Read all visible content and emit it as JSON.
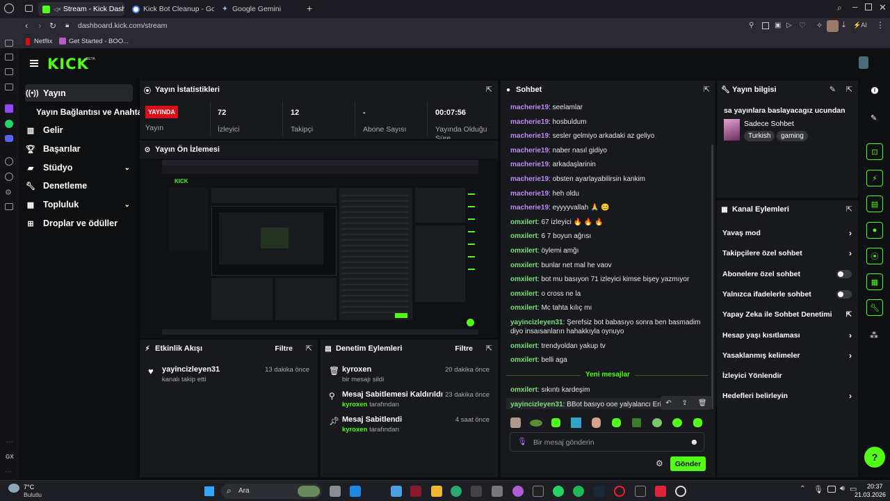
{
  "browser": {
    "tabs": [
      {
        "label": "Stream - Kick Dashbo",
        "active": true
      },
      {
        "label": "Kick Bot Cleanup - Googl",
        "active": false
      },
      {
        "label": "Google Gemini",
        "active": false
      }
    ],
    "url": "dashboard.kick.com/stream",
    "bookmarks": [
      "Netflix",
      "Get Started - BOO..."
    ]
  },
  "app": {
    "logo": "KICK",
    "logo_badge": "BETA",
    "accent": "#53fc18"
  },
  "nav": {
    "items": [
      {
        "label": "Yayın",
        "icon": "broadcast-icon"
      },
      {
        "label": "Yayın Bağlantısı ve Anahtarı"
      },
      {
        "label": "Gelir",
        "icon": "chart-icon"
      },
      {
        "label": "Başarılar",
        "icon": "trophy-icon"
      },
      {
        "label": "Stüdyo",
        "icon": "video-icon"
      },
      {
        "label": "Denetleme",
        "icon": "wrench-icon"
      },
      {
        "label": "Topluluk",
        "icon": "community-icon"
      },
      {
        "label": "Droplar ve ödüller",
        "icon": "gift-icon"
      }
    ]
  },
  "stats": {
    "title": "Yayın İstatistikleri",
    "live_badge": "YAYINDA",
    "live_label": "Yayın",
    "items": [
      {
        "value": "72",
        "label": "İzleyici"
      },
      {
        "value": "12",
        "label": "Takipçi"
      },
      {
        "value": "-",
        "label": "Abone Sayısı"
      },
      {
        "value": "00:07:56",
        "label": "Yayında Olduğu Süre"
      }
    ]
  },
  "preview": {
    "title": "Yayın Ön İzlemesi"
  },
  "activity": {
    "title": "Etkinlik Akışı",
    "filter": "Filtre",
    "items": [
      {
        "user": "yayincizleyen31",
        "text": "kanalı takip etti",
        "time": "13 dakika önce"
      }
    ]
  },
  "moderation": {
    "title": "Denetim Eylemleri",
    "filter": "Filtre",
    "items": [
      {
        "title": "kyroxen",
        "sub": "bir mesajı sildi",
        "time": "20 dakika önce"
      },
      {
        "title": "Mesaj Sabitlemesi Kaldırıldı",
        "user": "kyroxen",
        "sub": "tarafından",
        "time": "23 dakika önce"
      },
      {
        "title": "Mesaj Sabitlendi",
        "user": "kyroxen",
        "sub": "tarafından",
        "time": "4 saat önce"
      }
    ]
  },
  "chat": {
    "title": "Sohbet",
    "messages": [
      {
        "user": "macherie19",
        "text": "seelamlar",
        "color": "purple"
      },
      {
        "user": "macherie19",
        "text": "hosbuldum",
        "color": "purple"
      },
      {
        "user": "macherie19",
        "text": "sesler gelmiyo arkadaki az geliyo",
        "color": "purple"
      },
      {
        "user": "macherie19",
        "text": "naber nasıl gidiyo",
        "color": "purple"
      },
      {
        "user": "macherie19",
        "text": "arkadaşlarinin",
        "color": "purple"
      },
      {
        "user": "macherie19",
        "text": "obsten ayarlayabilirsin kankim",
        "color": "purple"
      },
      {
        "user": "macherie19",
        "text": "heh oldu",
        "color": "purple"
      },
      {
        "user": "macherie19",
        "text": "eyyyyvallah 🙏 😊",
        "color": "purple"
      },
      {
        "user": "omxilert",
        "text": "67 izleyici 🔥 🔥 🔥",
        "color": "green"
      },
      {
        "user": "omxilert",
        "text": "6 7 boyun ağrısı",
        "color": "green"
      },
      {
        "user": "omxilert",
        "text": "öylemi amğı",
        "color": "green"
      },
      {
        "user": "omxilert",
        "text": "bunlar net mal he vaov",
        "color": "green"
      },
      {
        "user": "omxilert",
        "text": "bot mu basıyon 71 izleyici kimse bişey yazmıyor",
        "color": "green"
      },
      {
        "user": "omxilert",
        "text": "o cross ne la",
        "color": "green"
      },
      {
        "user": "omxilert",
        "text": "Mc tahta kılıç mı",
        "color": "green"
      },
      {
        "user": "yayincizleyen31",
        "text": "Şerefsiz bot babasıyo sonra ben basmadim diyo insaısanların hahakkıyla oynuyo",
        "color": "green"
      },
      {
        "user": "omxilert",
        "text": "trendyoldan yakup tv",
        "color": "green"
      },
      {
        "user": "omxilert",
        "text": "belli aga",
        "color": "green"
      }
    ],
    "new_messages_label": "Yeni mesajlar",
    "new_messages": [
      {
        "user": "omxilert",
        "text": "sıkıntı kardeşim",
        "color": "green"
      },
      {
        "user": "yayincizleyen31",
        "text": "BBot basıyo ooe yalyalancı Erip",
        "color": "green"
      }
    ],
    "input_placeholder": "Bir mesaj gönderin",
    "send_label": "Gönder"
  },
  "stream_info": {
    "title": "Yayın bilgisi",
    "stream_title": "sa yayınlara baslayacagız ucundan",
    "category": "Sadece Sohbet",
    "tags": [
      "Turkish",
      "gaming"
    ]
  },
  "channel_actions": {
    "title": "Kanal Eylemleri",
    "items": [
      {
        "label": "Yavaş mod",
        "control": "chevron"
      },
      {
        "label": "Takipçilere özel sohbet",
        "control": "chevron"
      },
      {
        "label": "Abonelere özel sohbet",
        "control": "toggle"
      },
      {
        "label": "Yalnızca ifadelerle sohbet",
        "control": "toggle"
      },
      {
        "label": "Yapay Zeka ile Sohbet Denetimi",
        "control": "external"
      },
      {
        "label": "Hesap yaşı kısıtlaması",
        "control": "chevron"
      },
      {
        "label": "Yasaklanmış kelimeler",
        "control": "chevron"
      },
      {
        "label": "İzleyici Yönlendir",
        "control": "none"
      },
      {
        "label": "Hedefleri belirleyin",
        "control": "chevron"
      }
    ]
  },
  "taskbar": {
    "weather_temp": "7°C",
    "weather_text": "Bulutlu",
    "search": "Ara",
    "time": "20:37",
    "date": "21.03.2026"
  }
}
